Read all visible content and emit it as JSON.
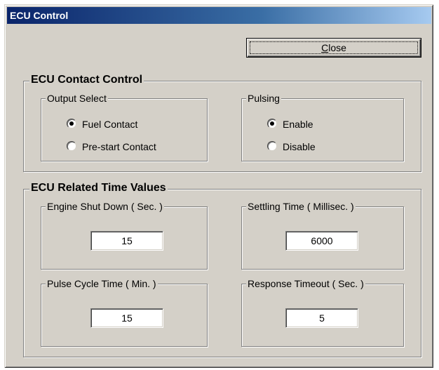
{
  "window": {
    "title": "ECU Control"
  },
  "toolbar": {
    "close_label_mnemonic": "C",
    "close_label_rest": "lose"
  },
  "contact_control": {
    "title": "ECU Contact Control",
    "output_select": {
      "title": "Output Select",
      "options": [
        {
          "label": "Fuel Contact",
          "checked": true
        },
        {
          "label": "Pre-start Contact",
          "checked": false
        }
      ]
    },
    "pulsing": {
      "title": "Pulsing",
      "options": [
        {
          "label": "Enable",
          "checked": true
        },
        {
          "label": "Disable",
          "checked": false
        }
      ]
    }
  },
  "time_values": {
    "title": "ECU Related Time Values",
    "engine_shut_down": {
      "label": "Engine Shut Down ( Sec. )",
      "value": "15"
    },
    "settling_time": {
      "label": "Settling Time ( Millisec. )",
      "value": "6000"
    },
    "pulse_cycle_time": {
      "label": "Pulse Cycle Time ( Min. )",
      "value": "15"
    },
    "response_timeout": {
      "label": "Response Timeout ( Sec. )",
      "value": "5"
    }
  }
}
